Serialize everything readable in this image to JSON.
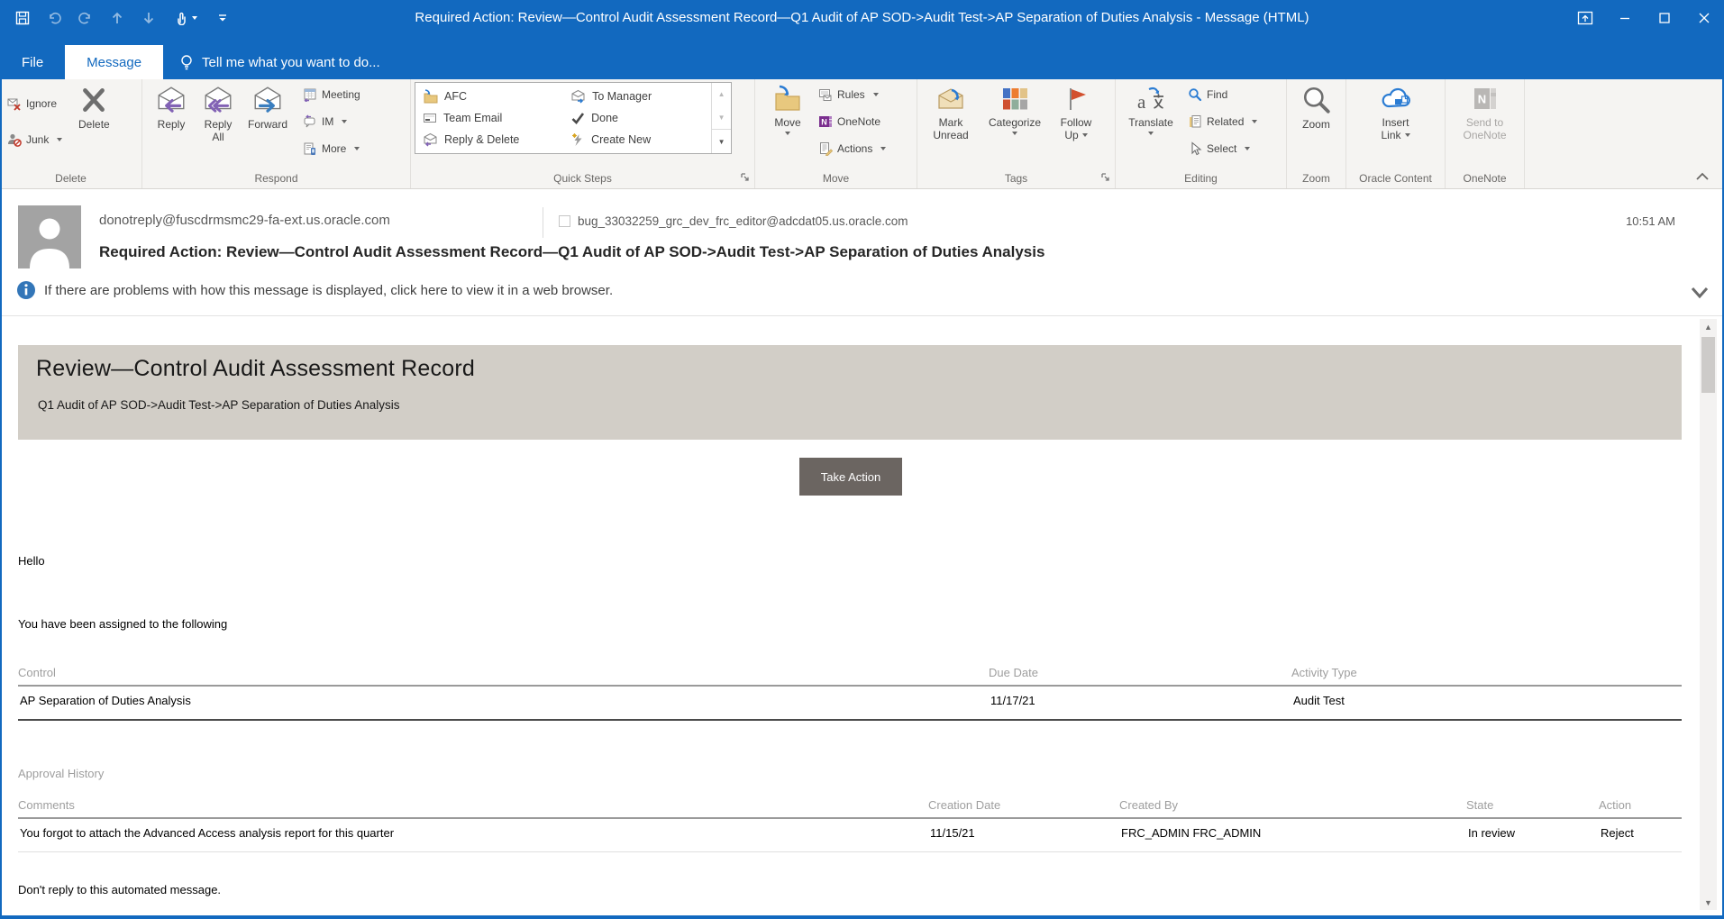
{
  "window": {
    "title": "Required Action: Review—Control Audit Assessment Record—Q1 Audit of AP SOD->Audit Test->AP Separation of Duties Analysis - Message (HTML)"
  },
  "tabs": {
    "file": "File",
    "message": "Message",
    "tell_me": "Tell me what you want to do..."
  },
  "ribbon": {
    "delete": {
      "ignore": "Ignore",
      "junk": "Junk",
      "del": "Delete",
      "label": "Delete"
    },
    "respond": {
      "reply": "Reply",
      "reply_all": "Reply All",
      "forward": "Forward",
      "meeting": "Meeting",
      "im": "IM",
      "more": "More",
      "label": "Respond"
    },
    "quick_steps": {
      "afc": "AFC",
      "team_email": "Team Email",
      "reply_delete": "Reply & Delete",
      "to_manager": "To Manager",
      "done": "Done",
      "create_new": "Create New",
      "label": "Quick Steps"
    },
    "move": {
      "move": "Move",
      "rules": "Rules",
      "onenote": "OneNote",
      "actions": "Actions",
      "label": "Move"
    },
    "tags": {
      "mark_unread": "Mark Unread",
      "categorize": "Categorize",
      "follow_up": "Follow Up",
      "label": "Tags"
    },
    "editing": {
      "translate": "Translate",
      "find": "Find",
      "related": "Related",
      "select": "Select",
      "label": "Editing"
    },
    "zoom": {
      "zoom": "Zoom",
      "label": "Zoom"
    },
    "oracle": {
      "insert_link": "Insert Link",
      "label": "Oracle Content"
    },
    "onenote": {
      "send": "Send to OneNote",
      "label": "OneNote"
    }
  },
  "header": {
    "sender": "donotreply@fuscdrmsmc29-fa-ext.us.oracle.com",
    "recipient": "bug_33032259_grc_dev_frc_editor@adcdat05.us.oracle.com",
    "time": "10:51 AM",
    "subject": "Required Action: Review—Control Audit Assessment Record—Q1 Audit of AP SOD->Audit Test->AP Separation of Duties Analysis",
    "info_bar": "If there are problems with how this message is displayed, click here to view it in a web browser."
  },
  "body": {
    "banner_title": "Review—Control Audit Assessment Record",
    "banner_subtitle": "Q1 Audit of AP SOD->Audit Test->AP Separation of Duties Analysis",
    "take_action": "Take Action",
    "greeting": "Hello",
    "assigned": "You have been assigned to the following",
    "assignment_table": {
      "headers": [
        "Control",
        "Due Date",
        "Activity Type"
      ],
      "row": [
        "AP Separation of Duties Analysis",
        "11/17/21",
        "Audit Test"
      ]
    },
    "approval_history": "Approval History",
    "approval_table": {
      "headers": [
        "Comments",
        "Creation Date",
        "Created By",
        "State",
        "Action"
      ],
      "row": [
        "You forgot to attach the Advanced Access analysis report for this quarter",
        "11/15/21",
        "FRC_ADMIN FRC_ADMIN",
        "In review",
        "Reject"
      ]
    },
    "footer": "Don't reply to this automated message."
  },
  "icons": {
    "scroll_up": "▲",
    "scroll_down": "▼"
  },
  "colors": {
    "titlebar": "#1269bf",
    "banner_bg": "#d2cec7",
    "take_action_bg": "#6b6561",
    "accent_blue": "#2b7cd3",
    "flag_red": "#d2502f"
  }
}
